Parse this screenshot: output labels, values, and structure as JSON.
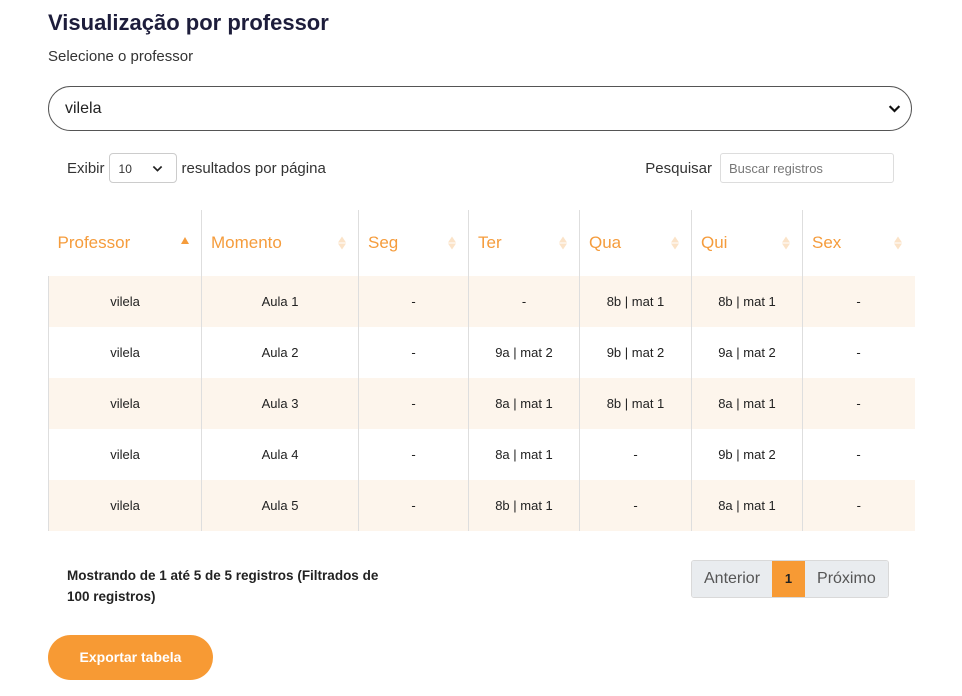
{
  "page": {
    "title": "Visualização por professor",
    "subtitle": "Selecione o professor"
  },
  "professor_select": {
    "value": "vilela"
  },
  "controls": {
    "show_label": "Exibir",
    "page_length": "10",
    "per_page_label": "resultados por página",
    "search_label": "Pesquisar",
    "search_placeholder": "Buscar registros",
    "search_value": ""
  },
  "table": {
    "columns": [
      "Professor",
      "Momento",
      "Seg",
      "Ter",
      "Qua",
      "Qui",
      "Sex"
    ],
    "sorted_column": "Professor",
    "rows": [
      [
        "vilela",
        "Aula 1",
        "-",
        "-",
        "8b | mat 1",
        "8b | mat 1",
        "-"
      ],
      [
        "vilela",
        "Aula 2",
        "-",
        "9a | mat 2",
        "9b | mat 2",
        "9a | mat 2",
        "-"
      ],
      [
        "vilela",
        "Aula 3",
        "-",
        "8a | mat 1",
        "8b | mat 1",
        "8a | mat 1",
        "-"
      ],
      [
        "vilela",
        "Aula 4",
        "-",
        "8a | mat 1",
        "-",
        "9b | mat 2",
        "-"
      ],
      [
        "vilela",
        "Aula 5",
        "-",
        "8b | mat 1",
        "-",
        "8a | mat 1",
        "-"
      ]
    ]
  },
  "footer": {
    "info_text": "Mostrando de 1 até 5 de 5 registros (Filtrados de 100 registros)",
    "prev_label": "Anterior",
    "current_page": "1",
    "next_label": "Próximo",
    "export_label": "Exportar tabela"
  },
  "colors": {
    "accent": "#f79a34",
    "header_text": "#f59c3c",
    "row_stripe": "#fdf5ec",
    "title": "#1d1d3b"
  },
  "icons": {
    "select_arrow": "chevron-down-icon",
    "sort_asc": "sort-asc-icon",
    "sort_both": "sort-icon"
  }
}
